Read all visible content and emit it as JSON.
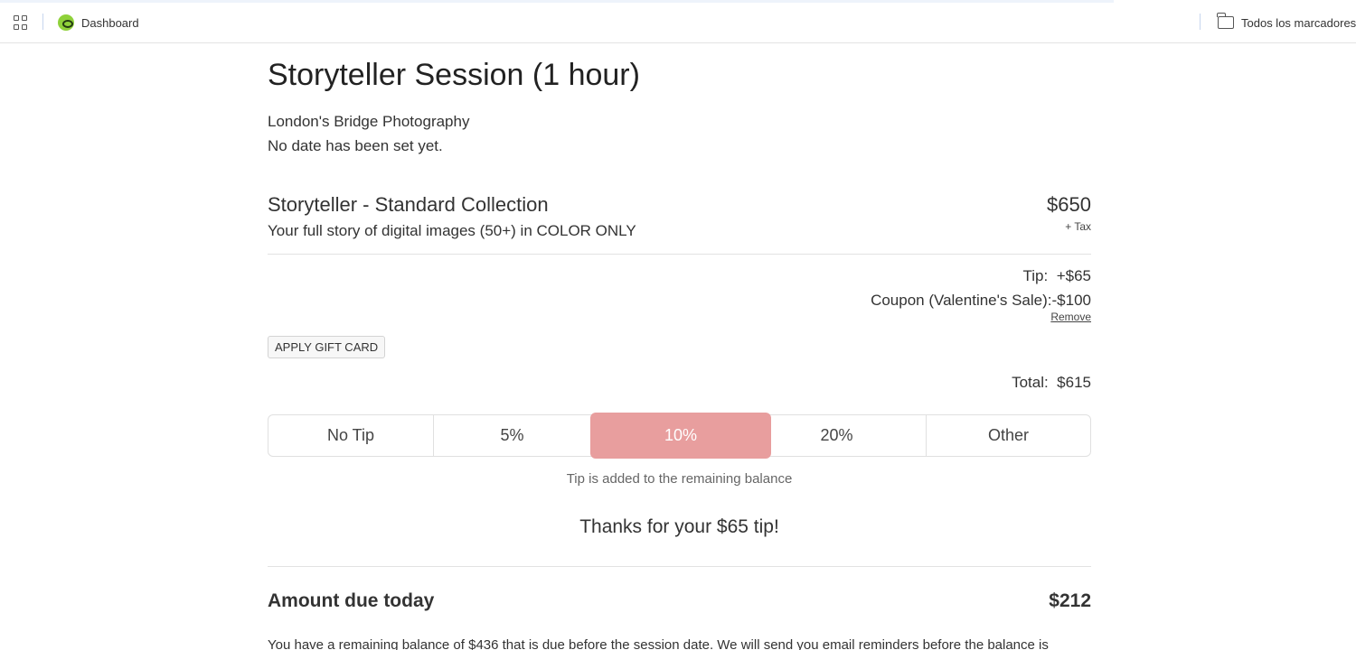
{
  "bookmarks_bar": {
    "dashboard_label": "Dashboard",
    "folder_label": "Todos los marcadores",
    "icons": {
      "apps": "apps-grid-icon",
      "dashboard": "dashboard-favicon-icon",
      "folder": "folder-icon"
    },
    "colors": {
      "favicon": "#8fd13a"
    }
  },
  "session": {
    "title": "Storyteller Session (1 hour)",
    "business": "London's Bridge Photography",
    "date_note": "No date has been set yet."
  },
  "package": {
    "name": "Storyteller - Standard Collection",
    "description": "Your full story of digital images (50+) in COLOR ONLY",
    "price": "$650",
    "price_note": "+ Tax"
  },
  "summary": {
    "tip_label": "Tip:",
    "tip_value": "+$65",
    "coupon_label": "Coupon (Valentine's Sale):",
    "coupon_value": "-$100",
    "remove_label": "Remove",
    "gift_card_button": "APPLY GIFT CARD",
    "total_label": "Total:",
    "total_value": "$615"
  },
  "tip_options": {
    "options": [
      "No Tip",
      "5%",
      "10%",
      "20%",
      "Other"
    ],
    "selected": "10%",
    "note": "Tip is added to the remaining balance",
    "thanks": "Thanks for your $65 tip!",
    "colors": {
      "selected": "#e89e9e"
    }
  },
  "amount_due": {
    "label": "Amount due today",
    "value": "$212",
    "balance_text": "You have a remaining balance of $436 that is due before the session date. We will send you email reminders before the balance is"
  }
}
